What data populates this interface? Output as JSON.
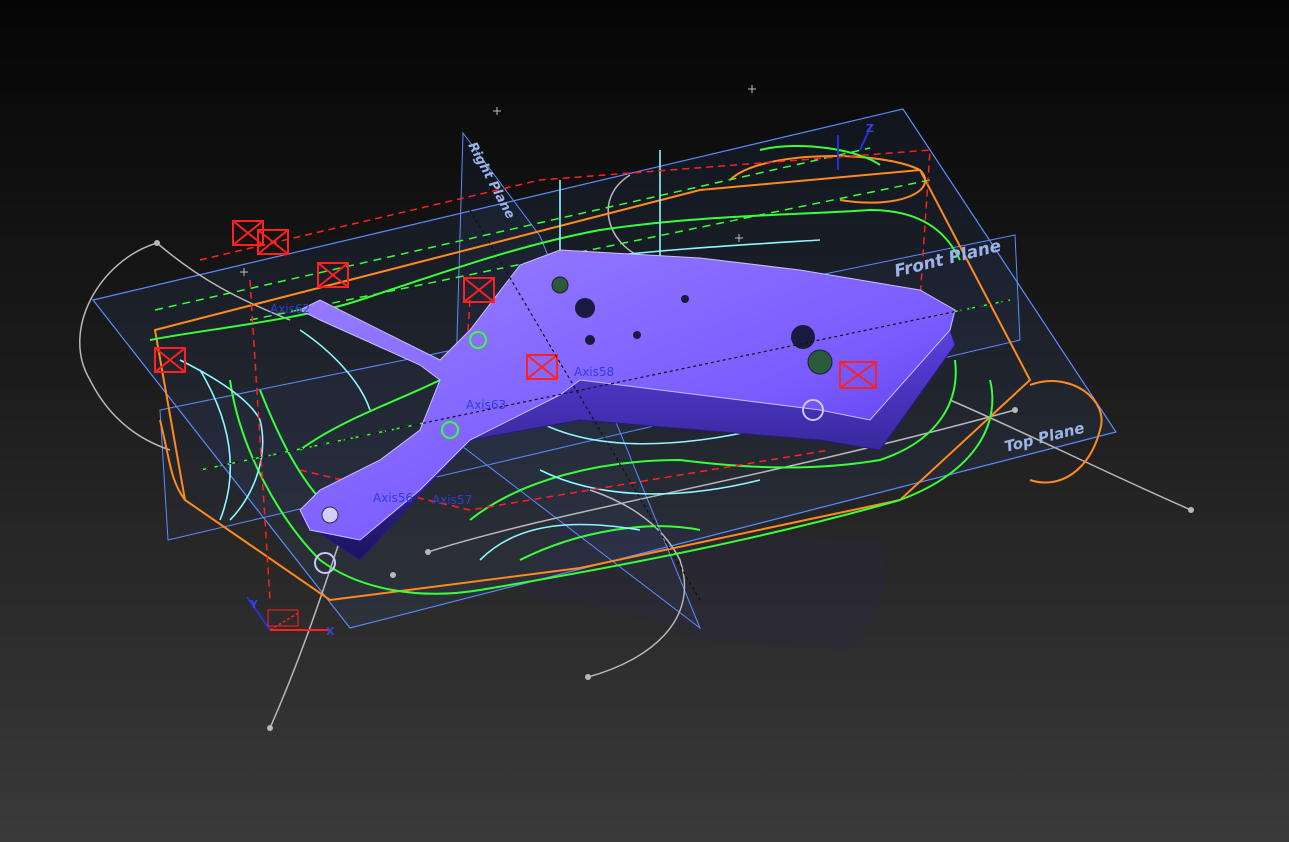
{
  "planes": {
    "front": "Front Plane",
    "top": "Top Plane",
    "right": "Right Plane"
  },
  "axes": {
    "axis62": "Axis62",
    "axis63": "Axis63",
    "axis56": "Axis56",
    "axis57": "Axis57",
    "axis58": "Axis58"
  },
  "triad": {
    "x": "X",
    "y": "Y",
    "z": "Z"
  },
  "colors": {
    "background_top": "#050505",
    "background_bottom": "#3a3a3a",
    "part_body": "#7a5cff",
    "plane_edge": "#5b8cff",
    "sketch_green": "#39ff3a",
    "sketch_cyan": "#8ff7ff",
    "sketch_orange": "#ff8a1e",
    "construction_red": "#ff2020",
    "spline_gray": "#b8b8b8"
  },
  "icons": [
    "origin-triad-icon",
    "reference-point-icon",
    "fixed-constraint-icon"
  ]
}
